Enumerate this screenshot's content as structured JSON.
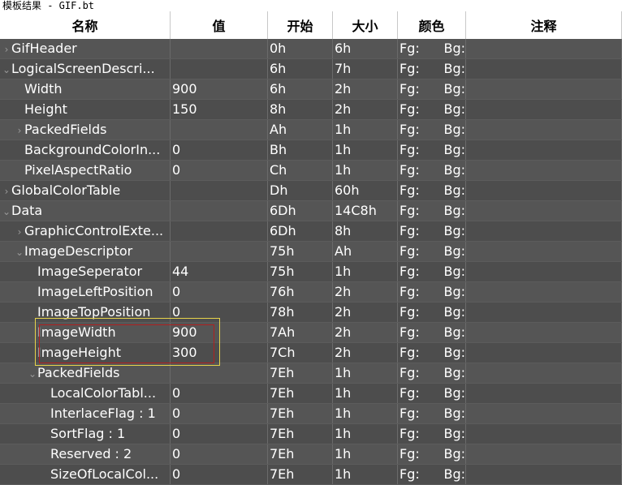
{
  "window": {
    "title": "模板结果 - GIF.bt"
  },
  "columns": [
    "名称",
    "值",
    "开始",
    "大小",
    "颜色",
    "注释"
  ],
  "rows": [
    {
      "indent": 0,
      "arrow": "›",
      "name": "GifHeader",
      "value": "",
      "start": "0h",
      "size": "6h",
      "fg": "Fg:",
      "bg": "Bg:"
    },
    {
      "indent": 0,
      "arrow": "⌄",
      "name": "LogicalScreenDescri...",
      "value": "",
      "start": "6h",
      "size": "7h",
      "fg": "Fg:",
      "bg": "Bg:"
    },
    {
      "indent": 1,
      "arrow": "",
      "name": "Width",
      "value": "900",
      "start": "6h",
      "size": "2h",
      "fg": "Fg:",
      "bg": "Bg:"
    },
    {
      "indent": 1,
      "arrow": "",
      "name": "Height",
      "value": "150",
      "start": "8h",
      "size": "2h",
      "fg": "Fg:",
      "bg": "Bg:"
    },
    {
      "indent": 1,
      "arrow": "›",
      "name": "PackedFields",
      "value": "",
      "start": "Ah",
      "size": "1h",
      "fg": "Fg:",
      "bg": "Bg:"
    },
    {
      "indent": 1,
      "arrow": "",
      "name": "BackgroundColorIn...",
      "value": "0",
      "start": "Bh",
      "size": "1h",
      "fg": "Fg:",
      "bg": "Bg:"
    },
    {
      "indent": 1,
      "arrow": "",
      "name": "PixelAspectRatio",
      "value": "0",
      "start": "Ch",
      "size": "1h",
      "fg": "Fg:",
      "bg": "Bg:"
    },
    {
      "indent": 0,
      "arrow": "›",
      "name": "GlobalColorTable",
      "value": "",
      "start": "Dh",
      "size": "60h",
      "fg": "Fg:",
      "bg": "Bg:"
    },
    {
      "indent": 0,
      "arrow": "⌄",
      "name": "Data",
      "value": "",
      "start": "6Dh",
      "size": "14C8h",
      "fg": "Fg:",
      "bg": "Bg:"
    },
    {
      "indent": 1,
      "arrow": "›",
      "name": "GraphicControlExte...",
      "value": "",
      "start": "6Dh",
      "size": "8h",
      "fg": "Fg:",
      "bg": "Bg:"
    },
    {
      "indent": 1,
      "arrow": "⌄",
      "name": "ImageDescriptor",
      "value": "",
      "start": "75h",
      "size": "Ah",
      "fg": "Fg:",
      "bg": "Bg:"
    },
    {
      "indent": 2,
      "arrow": "",
      "name": "ImageSeperator",
      "value": "44",
      "start": "75h",
      "size": "1h",
      "fg": "Fg:",
      "bg": "Bg:"
    },
    {
      "indent": 2,
      "arrow": "",
      "name": "ImageLeftPosition",
      "value": "0",
      "start": "76h",
      "size": "2h",
      "fg": "Fg:",
      "bg": "Bg:"
    },
    {
      "indent": 2,
      "arrow": "",
      "name": "ImageTopPosition",
      "value": "0",
      "start": "78h",
      "size": "2h",
      "fg": "Fg:",
      "bg": "Bg:"
    },
    {
      "indent": 2,
      "arrow": "",
      "name": "ImageWidth",
      "value": "900",
      "start": "7Ah",
      "size": "2h",
      "fg": "Fg:",
      "bg": "Bg:"
    },
    {
      "indent": 2,
      "arrow": "",
      "name": "ImageHeight",
      "value": "300",
      "start": "7Ch",
      "size": "2h",
      "fg": "Fg:",
      "bg": "Bg:"
    },
    {
      "indent": 2,
      "arrow": "⌄",
      "name": "PackedFields",
      "value": "",
      "start": "7Eh",
      "size": "1h",
      "fg": "Fg:",
      "bg": "Bg:"
    },
    {
      "indent": 3,
      "arrow": "",
      "name": "LocalColorTabl...",
      "value": "0",
      "start": "7Eh",
      "size": "1h",
      "fg": "Fg:",
      "bg": "Bg:"
    },
    {
      "indent": 3,
      "arrow": "",
      "name": "InterlaceFlag : 1",
      "value": "0",
      "start": "7Eh",
      "size": "1h",
      "fg": "Fg:",
      "bg": "Bg:"
    },
    {
      "indent": 3,
      "arrow": "",
      "name": "SortFlag : 1",
      "value": "0",
      "start": "7Eh",
      "size": "1h",
      "fg": "Fg:",
      "bg": "Bg:"
    },
    {
      "indent": 3,
      "arrow": "",
      "name": "Reserved : 2",
      "value": "0",
      "start": "7Eh",
      "size": "1h",
      "fg": "Fg:",
      "bg": "Bg:"
    },
    {
      "indent": 3,
      "arrow": "",
      "name": "SizeOfLocalCol...",
      "value": "0",
      "start": "7Eh",
      "size": "1h",
      "fg": "Fg:",
      "bg": "Bg:"
    }
  ]
}
